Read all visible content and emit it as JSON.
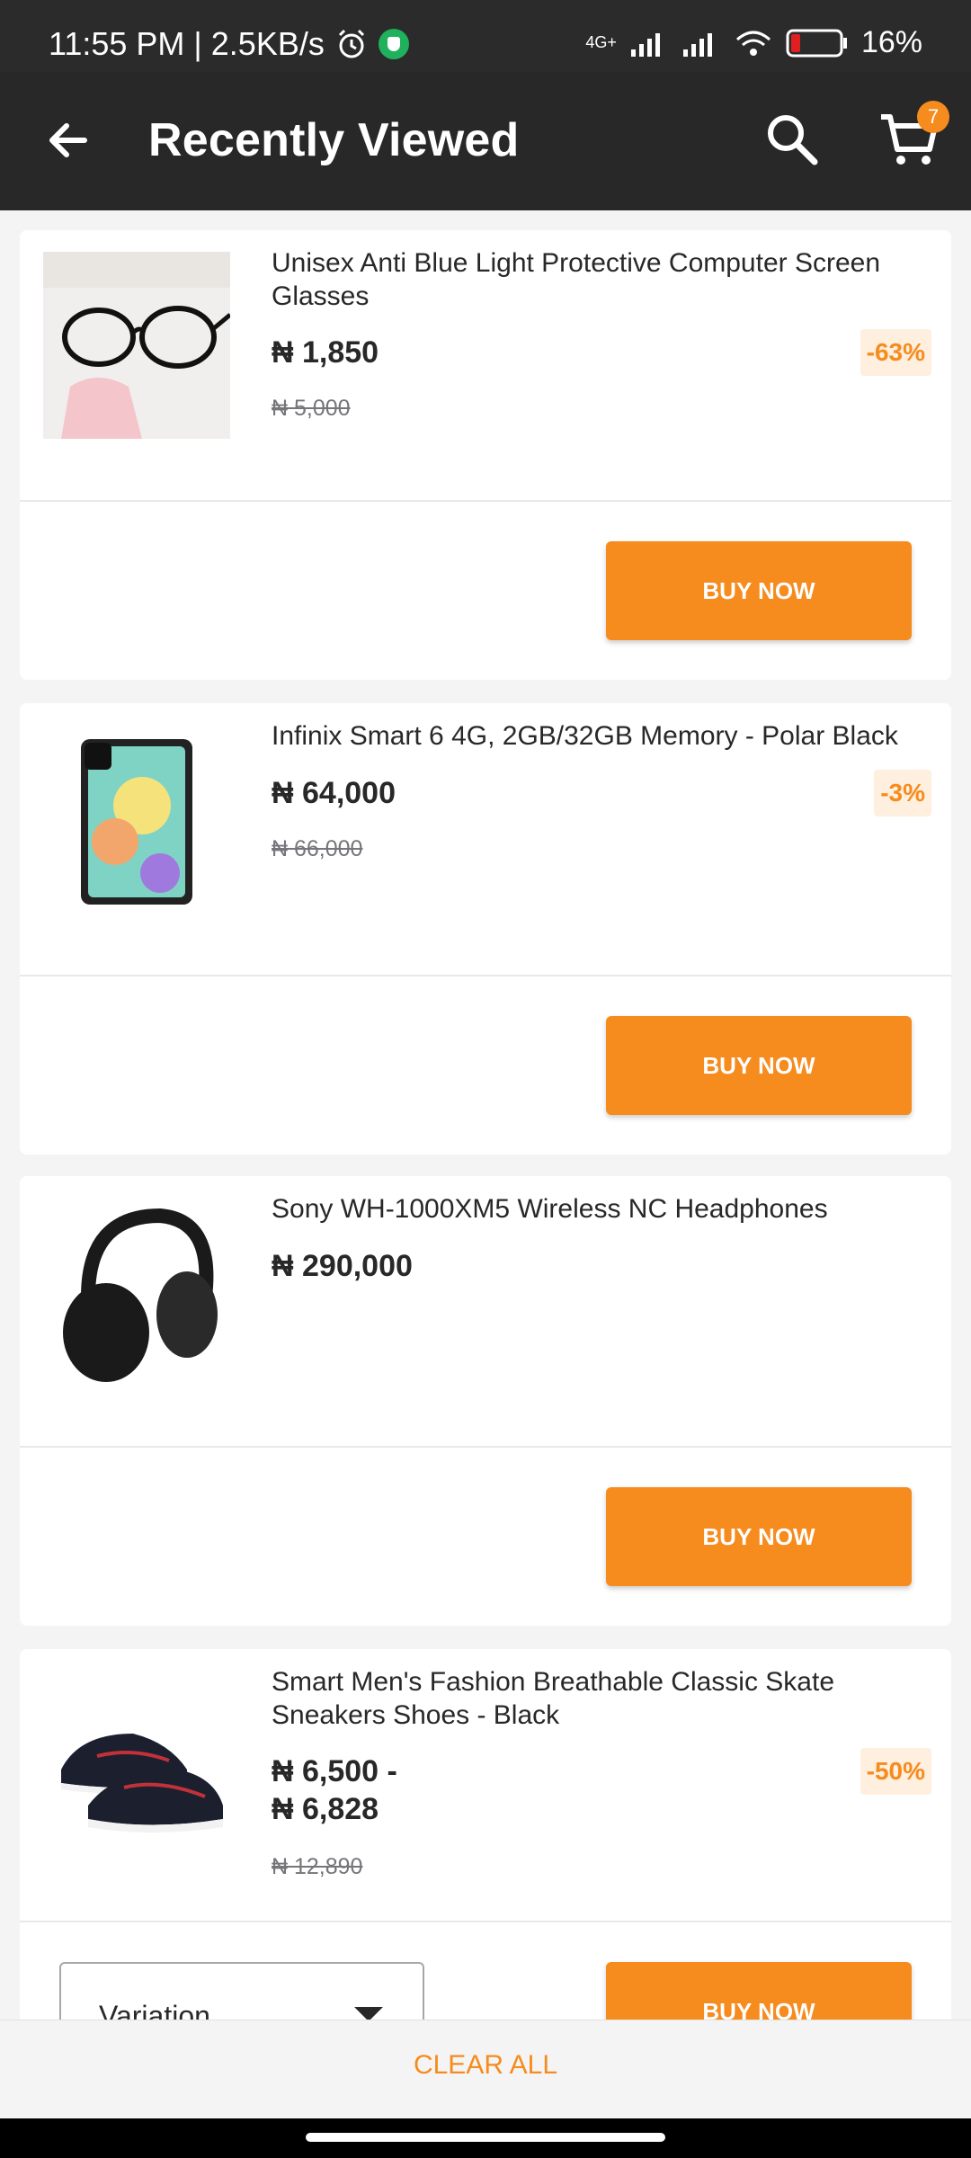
{
  "status": {
    "left_text": "11:55 PM | 2.5KB/s",
    "network": "4G+",
    "battery": "16%"
  },
  "app_bar": {
    "title": "Recently Viewed",
    "cart_count": "7"
  },
  "products": [
    {
      "name": "Unisex Anti Blue Light Protective Computer Screen Glasses",
      "price": "₦ 1,850",
      "old_price": "₦ 5,000",
      "discount": "-63%",
      "buy_label": "BUY NOW"
    },
    {
      "name": "Infinix Smart 6 4G, 2GB/32GB Memory - Polar Black",
      "price": "₦ 64,000",
      "old_price": "₦ 66,000",
      "discount": "-3%",
      "buy_label": "BUY NOW"
    },
    {
      "name": "Sony WH-1000XM5 Wireless NC Headphones",
      "price": "₦ 290,000",
      "buy_label": "BUY NOW"
    },
    {
      "name": "Smart Men's Fashion Breathable Classic Skate Sneakers Shoes - Black",
      "price_line1": "₦ 6,500 -",
      "price_line2": "₦ 6,828",
      "old_price": "₦ 12,890",
      "discount": "-50%",
      "variation_label": "Variation",
      "buy_label": "BUY NOW"
    }
  ],
  "footer": {
    "clear_all": "CLEAR ALL"
  },
  "colors": {
    "accent": "#f68b1e",
    "app_bar": "#282828",
    "discount_bg": "#feefde"
  }
}
